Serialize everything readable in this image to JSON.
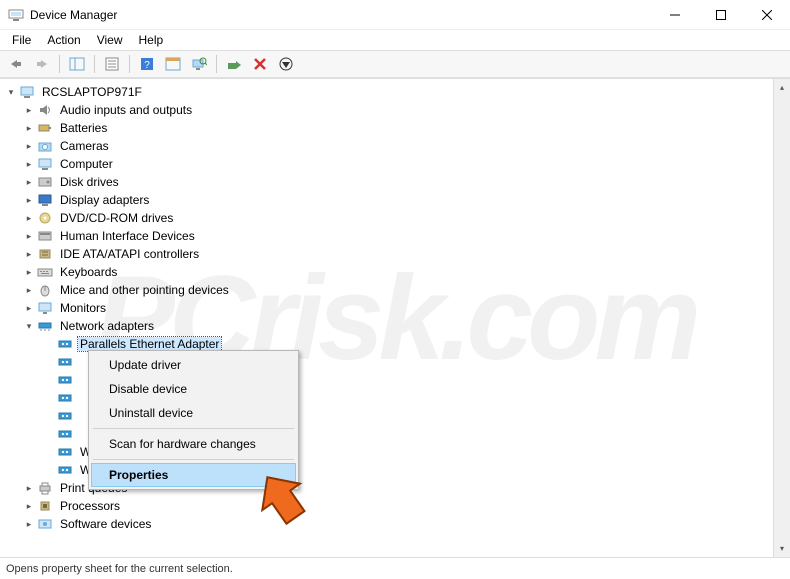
{
  "window": {
    "title": "Device Manager"
  },
  "menu": {
    "file": "File",
    "action": "Action",
    "view": "View",
    "help": "Help"
  },
  "tree": {
    "root": "RCSLAPTOP971F",
    "items": [
      "Audio inputs and outputs",
      "Batteries",
      "Cameras",
      "Computer",
      "Disk drives",
      "Display adapters",
      "DVD/CD-ROM drives",
      "Human Interface Devices",
      "IDE ATA/ATAPI controllers",
      "Keyboards",
      "Mice and other pointing devices",
      "Monitors",
      "Network adapters"
    ],
    "netadapters": [
      "Parallels Ethernet Adapter",
      "",
      "",
      "",
      "",
      "",
      "WAN Miniport (PPTP)",
      "WAN Miniport (SSTP)"
    ],
    "after": [
      "Print queues",
      "Processors",
      "Software devices"
    ]
  },
  "context_menu": {
    "update": "Update driver",
    "disable": "Disable device",
    "uninstall": "Uninstall device",
    "scan": "Scan for hardware changes",
    "properties": "Properties"
  },
  "status": {
    "text": "Opens property sheet for the current selection."
  },
  "watermark": "PCrisk.com"
}
